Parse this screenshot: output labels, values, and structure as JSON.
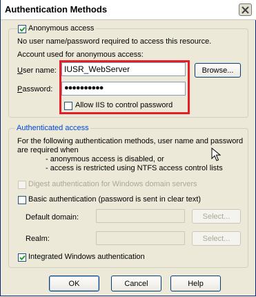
{
  "window": {
    "title": "Authentication Methods"
  },
  "anonymous": {
    "checkbox_label": "Anonymous access",
    "checked": true,
    "desc": "No user name/password required to access this resource.",
    "account_label": "Account used for anonymous access:",
    "username_label": "User name:",
    "username_value": "IUSR_WebServer",
    "password_label": "Password:",
    "password_value": "●●●●●●●●●●",
    "browse_label": "Browse...",
    "allow_iis_label": "Allow IIS to control password",
    "allow_iis_checked": false
  },
  "authenticated": {
    "group_title": "Authenticated access",
    "desc_line1": "For the following authentication methods, user name and password",
    "desc_line2": "are required when",
    "bullet1": "- anonymous access is disabled, or",
    "bullet2": "- access is restricted using NTFS access control lists",
    "digest_label": "Digest authentication for Windows domain servers",
    "digest_checked": false,
    "basic_label": "Basic authentication (password is sent in clear text)",
    "basic_checked": false,
    "default_domain_label": "Default domain:",
    "realm_label": "Realm:",
    "select_label": "Select...",
    "integrated_label": "Integrated Windows authentication",
    "integrated_checked": true
  },
  "footer": {
    "ok_label": "OK",
    "cancel_label": "Cancel",
    "help_label": "Help"
  },
  "colors": {
    "highlight_border": "#e81d25",
    "group_title_color": "#0046d5"
  }
}
